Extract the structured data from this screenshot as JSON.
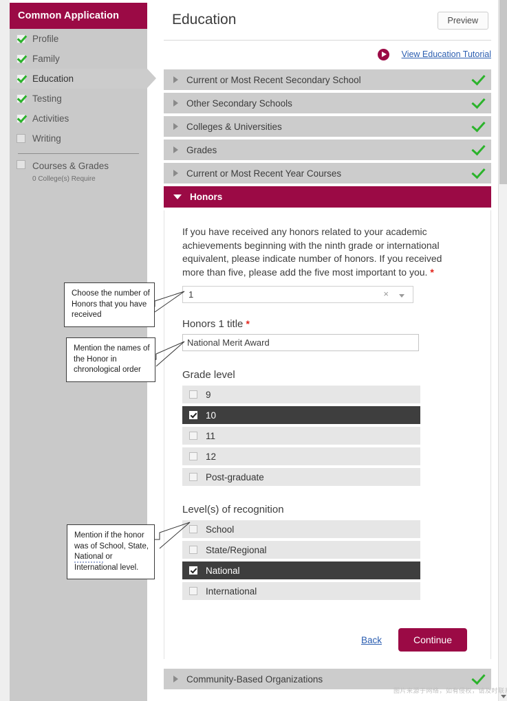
{
  "sidebar": {
    "title": "Common Application",
    "items": [
      {
        "label": "Profile",
        "checked": true,
        "active": false
      },
      {
        "label": "Family",
        "checked": true,
        "active": false
      },
      {
        "label": "Education",
        "checked": true,
        "active": true
      },
      {
        "label": "Testing",
        "checked": true,
        "active": false
      },
      {
        "label": "Activities",
        "checked": true,
        "active": false
      },
      {
        "label": "Writing",
        "checked": false,
        "active": false
      }
    ],
    "sub_item": {
      "label": "Courses & Grades",
      "note": "0 College(s) Require",
      "checked": false
    }
  },
  "header": {
    "title": "Education",
    "preview_label": "Preview",
    "tutorial_label": "View Education Tutorial",
    "play_icon": "play-circle-icon"
  },
  "accordion": [
    {
      "label": "Current or Most Recent Secondary School",
      "open": false,
      "complete": true
    },
    {
      "label": "Other Secondary Schools",
      "open": false,
      "complete": true
    },
    {
      "label": "Colleges & Universities",
      "open": false,
      "complete": true
    },
    {
      "label": "Grades",
      "open": false,
      "complete": true
    },
    {
      "label": "Current or Most Recent Year Courses",
      "open": false,
      "complete": true
    },
    {
      "label": "Honors",
      "open": true,
      "complete": false
    }
  ],
  "footer_accordion": {
    "label": "Community-Based Organizations",
    "open": false,
    "complete": true
  },
  "honors": {
    "intro": "If you have received any honors related to your academic achievements beginning with the ninth grade or international equivalent, please indicate number of honors. If you received more than five, please add the five most important to you.",
    "intro_required_mark": "*",
    "count_select": {
      "value": "1",
      "clear_icon": "×",
      "chevron": "chevron-down-icon"
    },
    "title_field": {
      "label": "Honors 1 title",
      "required_mark": "*",
      "value": "National Merit Award",
      "placeholder": ""
    },
    "grade_level": {
      "label": "Grade level",
      "options": [
        {
          "label": "9",
          "selected": false
        },
        {
          "label": "10",
          "selected": true
        },
        {
          "label": "11",
          "selected": false
        },
        {
          "label": "12",
          "selected": false
        },
        {
          "label": "Post-graduate",
          "selected": false
        }
      ]
    },
    "recognition": {
      "label": "Level(s) of recognition",
      "options": [
        {
          "label": "School",
          "selected": false
        },
        {
          "label": "State/Regional",
          "selected": false
        },
        {
          "label": "National",
          "selected": true
        },
        {
          "label": "International",
          "selected": false
        }
      ]
    },
    "actions": {
      "back_label": "Back",
      "continue_label": "Continue"
    }
  },
  "callouts": [
    {
      "id": "callout-honor-count",
      "lines": [
        "Choose the number of",
        "Honors that you have",
        "received"
      ]
    },
    {
      "id": "callout-honor-name",
      "lines": [
        "Mention the names of",
        "the Honor in",
        "chronological order"
      ]
    },
    {
      "id": "callout-recognition-level",
      "lines": [
        "Mention if the honor",
        "was of School, State,",
        "National or",
        "International level."
      ]
    }
  ],
  "watermark": "图片来源于网络，如有侵权，请及时联系删除。",
  "colors": {
    "brand_maroon": "#9b0a45",
    "sidebar_gray": "#c9c9c9",
    "accordion_gray": "#cccccc",
    "selected_row": "#3e3e3e",
    "check_green": "#2bb32b",
    "link_blue": "#2a5db0",
    "required_red": "#e2231a"
  }
}
